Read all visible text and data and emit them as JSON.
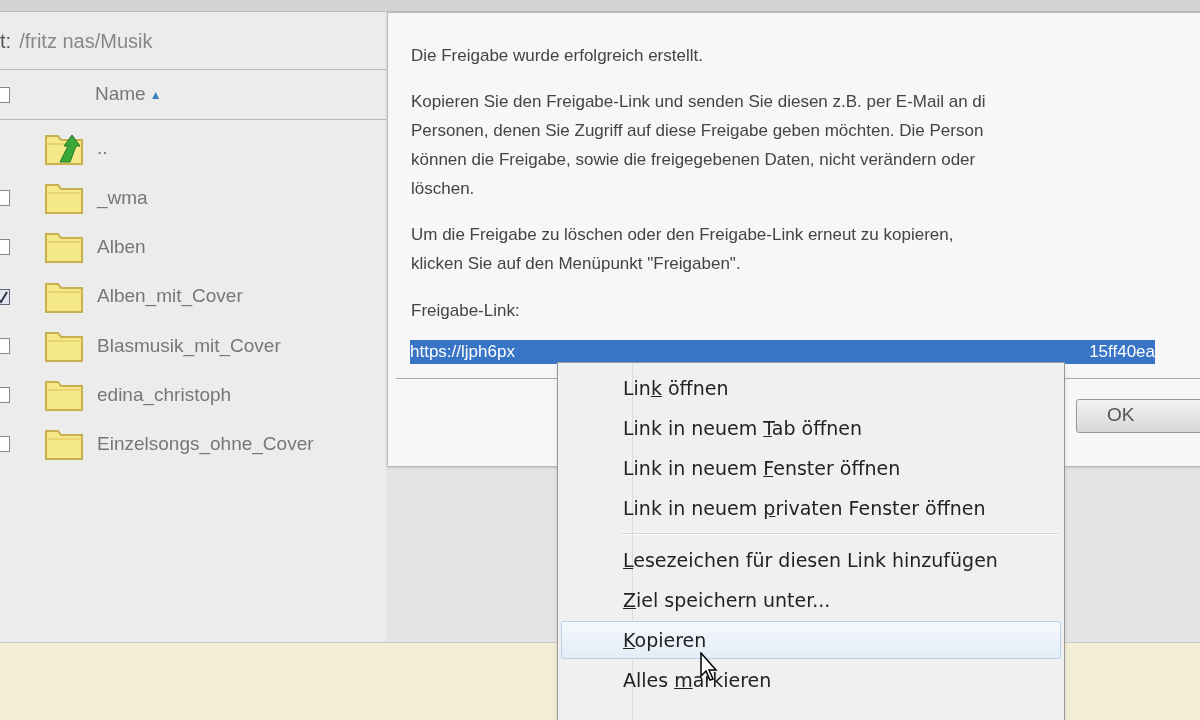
{
  "path": {
    "label": "t:",
    "value": "/fritz nas/Musik"
  },
  "file_list": {
    "header": {
      "checked": false,
      "label": "Name",
      "sort_indicator": "▲"
    },
    "rows": [
      {
        "kind": "parent",
        "name": "..",
        "checked": false
      },
      {
        "kind": "folder",
        "name": "_wma",
        "checked": false
      },
      {
        "kind": "folder",
        "name": "Alben",
        "checked": false
      },
      {
        "kind": "folder",
        "name": "Alben_mit_Cover",
        "checked": true
      },
      {
        "kind": "folder",
        "name": "Blasmusik_mit_Cover",
        "checked": false
      },
      {
        "kind": "folder",
        "name": "edina_christoph",
        "checked": false
      },
      {
        "kind": "folder",
        "name": "Einzelsongs_ohne_Cover",
        "checked": false
      }
    ]
  },
  "dialog": {
    "paragraphs": [
      {
        "lines": [
          "Die Freigabe wurde erfolgreich erstellt."
        ]
      },
      {
        "lines": [
          "Kopieren Sie den Freigabe-Link und senden Sie diesen z.B. per E-Mail an di",
          "Personen, denen Sie Zugriff auf diese Freigabe geben möchten. Die Person",
          "können die Freigabe, sowie die freigegebenen Daten, nicht verändern oder",
          "löschen."
        ]
      },
      {
        "lines": [
          "Um die Freigabe zu löschen oder den Freigabe-Link erneut zu kopieren,",
          "klicken Sie auf den Menüpunkt \"Freigaben\"."
        ]
      }
    ],
    "link_label": "Freigabe-Link:",
    "link": {
      "start": "https://ljph6px",
      "end": "15ff40ea",
      "selected": true
    },
    "buttons": [
      "OK"
    ]
  },
  "context_menu": {
    "items": [
      {
        "kind": "item",
        "before": "Lin",
        "key": "k",
        "after": " öffnen",
        "selected": false
      },
      {
        "kind": "item",
        "before": "Link in neuem ",
        "key": "T",
        "after": "ab öffnen",
        "selected": false
      },
      {
        "kind": "item",
        "before": "Link in neuem ",
        "key": "F",
        "after": "enster öffnen",
        "selected": false
      },
      {
        "kind": "item",
        "before": "Link in neuem ",
        "key": "p",
        "after": "rivaten Fenster öffnen",
        "selected": false
      },
      {
        "kind": "separator"
      },
      {
        "kind": "item",
        "key": "L",
        "after": "esezeichen für diesen Link hinzufügen",
        "selected": false
      },
      {
        "kind": "item",
        "key": "Z",
        "after": "iel speichern unter...",
        "selected": false
      },
      {
        "kind": "item",
        "key": "K",
        "after": "opieren",
        "selected": true
      },
      {
        "kind": "item",
        "before": "Alles ",
        "key": "m",
        "after": "arkieren",
        "selected": false
      }
    ]
  }
}
